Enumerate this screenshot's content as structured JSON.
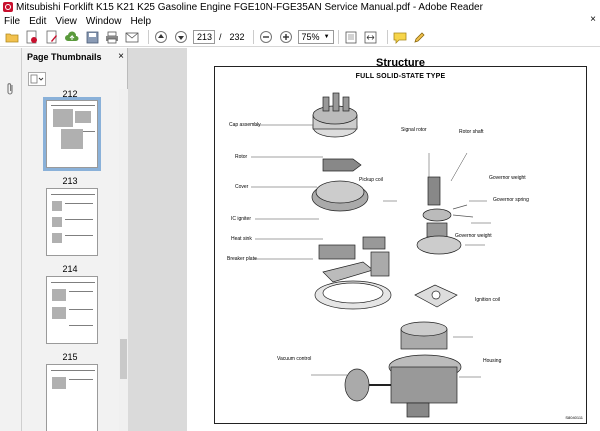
{
  "window": {
    "title": "Mitsubishi Forklift K15 K21 K25 Gasoline Engine FGE10N-FGE35AN Service Manual.pdf - Adobe Reader"
  },
  "menu": {
    "items": [
      "File",
      "Edit",
      "View",
      "Window",
      "Help"
    ],
    "close": "×"
  },
  "toolbar": {
    "current_page": "213",
    "page_separator": "/",
    "total_pages": "232",
    "zoom": "75%"
  },
  "thumbnails": {
    "title": "Page Thumbnails",
    "close": "×",
    "pages": [
      {
        "label": "212",
        "selected": true
      },
      {
        "label": "213",
        "selected": false
      },
      {
        "label": "214",
        "selected": false
      },
      {
        "label": "215",
        "selected": false
      }
    ]
  },
  "document": {
    "heading": "Structure",
    "subtitle": "FULL SOLID-STATE TYPE",
    "figure_code": "S8040111",
    "callouts": [
      "Cap assembly",
      "Rotor",
      "Cover",
      "IC igniter",
      "Heat sink",
      "Breaker plate",
      "Pickup coil",
      "Signal rotor",
      "Rotor shaft",
      "Governor weight",
      "Governor spring",
      "Governor weight",
      "Ignition coil",
      "Vacuum control",
      "Housing"
    ]
  },
  "colors": {
    "accent": "#c8102e",
    "selection": "#8ab1d9",
    "viewer_bg": "#dadada"
  }
}
